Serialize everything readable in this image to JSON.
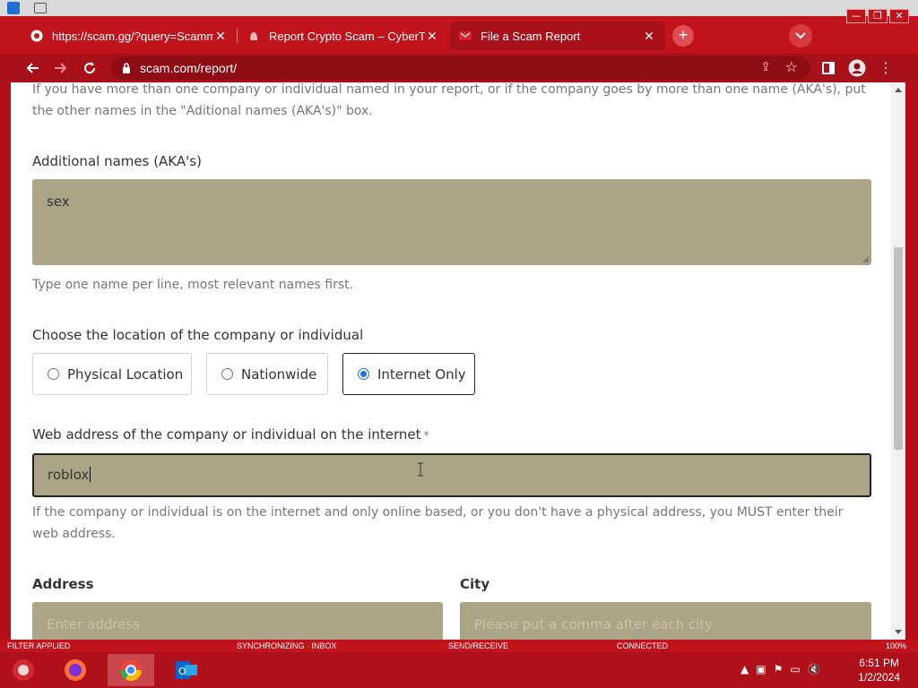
{
  "browser": {
    "tabs": [
      {
        "title": "https://scam.gg/?query=Scamm",
        "icon": "search-favicon"
      },
      {
        "title": "Report Crypto Scam – CyberTrail",
        "icon": "cybertrail-favicon"
      },
      {
        "title": "File a Scam Report",
        "icon": "scam-favicon",
        "active": true
      }
    ],
    "url": "scam.com/report/"
  },
  "form": {
    "intro_text": "If you have more than one company or individual named in your report, or if the company goes by more than one name (AKA's), put the other names in the \"Aditional names (AKA's)\" box.",
    "aka": {
      "label": "Additional names (AKA's)",
      "value": "sex",
      "help": "Type one name per line, most relevant names first."
    },
    "location": {
      "label": "Choose the location of the company or individual",
      "options": [
        "Physical Location",
        "Nationwide",
        "Internet Only"
      ],
      "selected": "Internet Only"
    },
    "web": {
      "label": "Web address of the company or individual on the internet",
      "required_mark": "*",
      "value": "roblox",
      "help": "If the company or individual is on the internet and only online based, or you don't have a physical address, you MUST enter their web address."
    },
    "address": {
      "label": "Address",
      "placeholder": "Enter address"
    },
    "city": {
      "label": "City",
      "placeholder": "Please put a comma after each city"
    }
  },
  "statusbar": {
    "filter": "FILTER APPLIED",
    "sync": "SYNCHRONIZING · INBOX",
    "send": "SEND/RECEIVE",
    "connected": "CONNECTED",
    "zoom": "100%"
  },
  "taskbar": {
    "apps": [
      "firefox-icon",
      "chrome-icon",
      "outlook-icon"
    ],
    "time": "6:51 PM",
    "date": "1/2/2024"
  },
  "colors": {
    "chrome_red": "#c0131b",
    "field_fill": "#aba486",
    "radio_accent": "#1a73e8"
  }
}
